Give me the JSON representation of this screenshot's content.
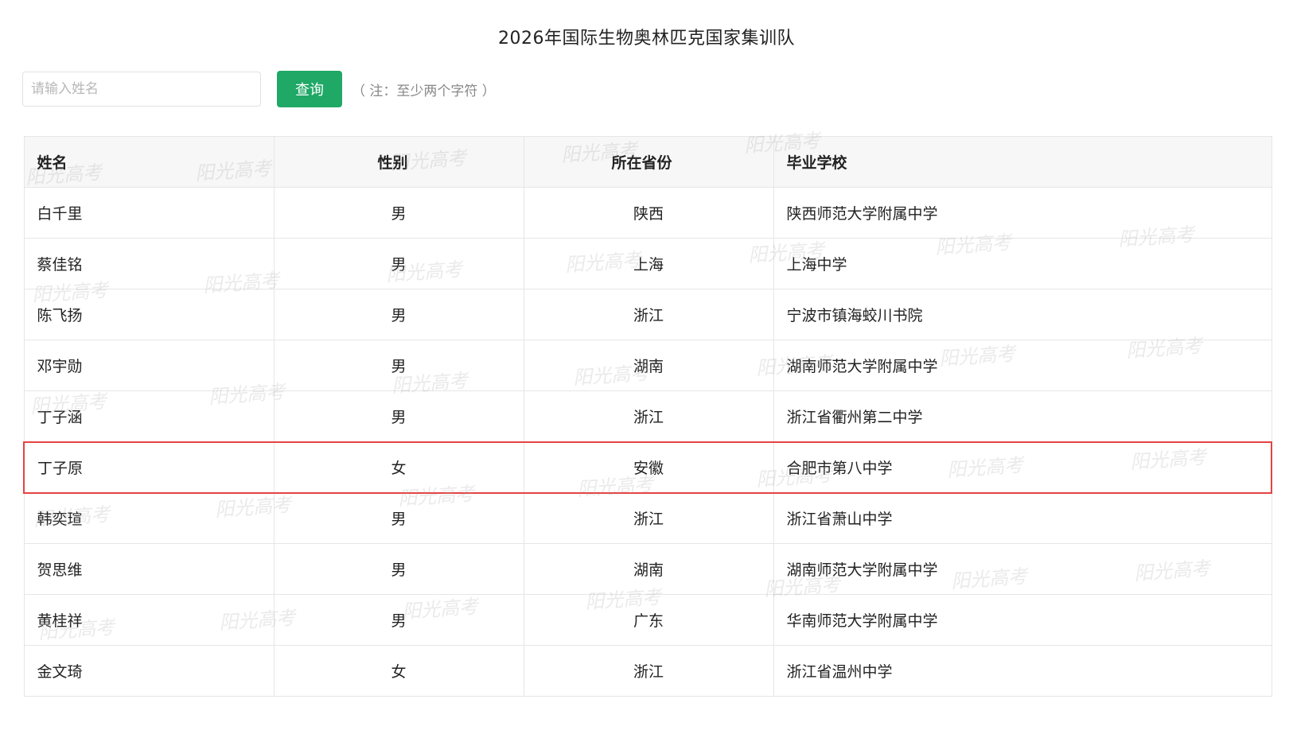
{
  "page": {
    "title": "2026年国际生物奥林匹克国家集训队"
  },
  "search": {
    "placeholder": "请输入姓名",
    "value": "",
    "button_label": "查询",
    "hint": "（ 注：至少两个字符 ）"
  },
  "table": {
    "headers": [
      "姓名",
      "性别",
      "所在省份",
      "毕业学校"
    ],
    "highlighted_row_index": 5,
    "highlight_color": "#e64242",
    "rows": [
      [
        "白千里",
        "男",
        "陕西",
        "陕西师范大学附属中学"
      ],
      [
        "蔡佳铭",
        "男",
        "上海",
        "上海中学"
      ],
      [
        "陈飞扬",
        "男",
        "浙江",
        "宁波市镇海蛟川书院"
      ],
      [
        "邓宇勋",
        "男",
        "湖南",
        "湖南师范大学附属中学"
      ],
      [
        "丁子涵",
        "男",
        "浙江",
        "浙江省衢州第二中学"
      ],
      [
        "丁子原",
        "女",
        "安徽",
        "合肥市第八中学"
      ],
      [
        "韩奕瑄",
        "男",
        "浙江",
        "浙江省萧山中学"
      ],
      [
        "贺思维",
        "男",
        "湖南",
        "湖南师范大学附属中学"
      ],
      [
        "黄桂祥",
        "男",
        "广东",
        "华南师范大学附属中学"
      ],
      [
        "金文琦",
        "女",
        "浙江",
        "浙江省温州中学"
      ]
    ]
  },
  "watermark": {
    "text": "阳光高考"
  },
  "colors": {
    "primary_button": "#1fa866",
    "header_background": "#f7f7f7",
    "border": "#e6e6e6"
  }
}
